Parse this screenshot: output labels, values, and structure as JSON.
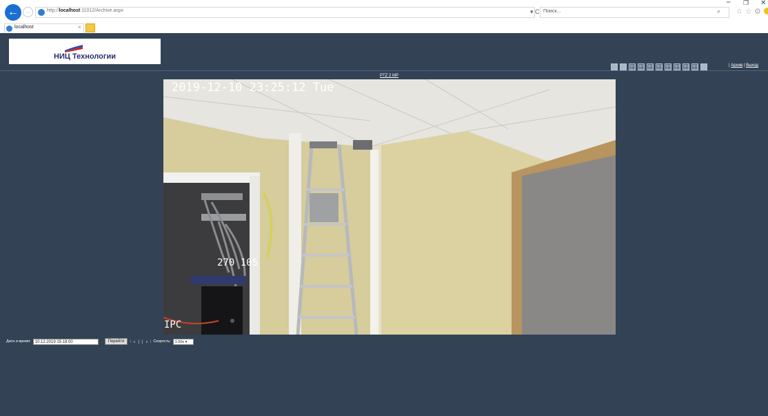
{
  "browser": {
    "url_prefix": "http://",
    "url_host": "localhost",
    "url_rest": ":11012/Archive.aspx",
    "addr_tools": "▾ C",
    "search_placeholder": "Поиск...",
    "tab_title": "localhost",
    "tab_close": "×",
    "win_min": "−",
    "win_max": "❐",
    "win_close": "✕",
    "icons": [
      "back-icon",
      "forward-icon",
      "refresh-icon",
      "search-icon",
      "home-icon",
      "star-icon",
      "gear-icon",
      "smiley-icon"
    ]
  },
  "header": {
    "logo_text": "НИЦ Технологии",
    "links": {
      "sep1": "|",
      "archive": "Архив",
      "sep2": "|",
      "logout": "Выход"
    }
  },
  "camera": {
    "title": "PTZ 2 MP",
    "osd_time": "2019-12-10 23:25:12 Tue",
    "osd_mid": "270 105",
    "osd_name": "IPC"
  },
  "controls": {
    "date_label": "Дата и время:",
    "date_value": "10.12.2019 15:18:00",
    "go_label": "Перейти",
    "sep": "|",
    "prev": "◂",
    "pause": "❙❙",
    "play": "▸",
    "speed_label": "Скорость:",
    "speed_value": "1.00x ▾"
  }
}
